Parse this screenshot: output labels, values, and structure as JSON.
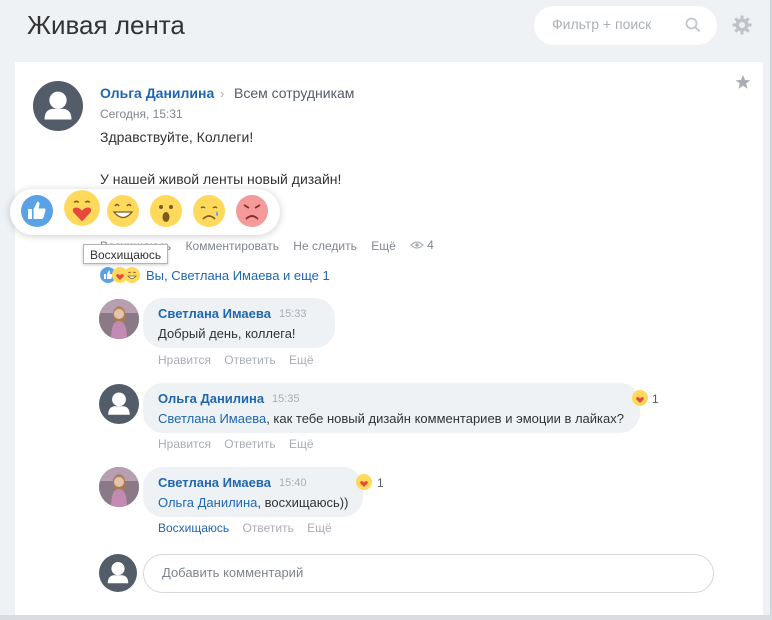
{
  "page": {
    "title": "Живая лента"
  },
  "search": {
    "placeholder": "Фильтр + поиск"
  },
  "post": {
    "author": "Ольга Данилина",
    "destination": "Всем сотрудникам",
    "time": "Сегодня, 15:31",
    "text_lines": [
      "Здравствуйте, Коллеги!",
      "У нашей живой ленты новый дизайн!"
    ],
    "actions": {
      "like": "Восхищаюсь",
      "comment": "Комментировать",
      "unfollow": "Не следить",
      "more": "Ещё"
    },
    "views": "4",
    "likers": "Вы, Светлана Имаева и еще 1"
  },
  "reactions": {
    "items": [
      "like",
      "kiss",
      "laugh",
      "wonder",
      "cry",
      "angry"
    ],
    "tooltip": "Восхищаюсь"
  },
  "comments": [
    {
      "author": "Светлана Имаева",
      "time": "15:33",
      "mention": "",
      "text": "Добрый день, коллега!",
      "actions": [
        "Нравится",
        "Ответить",
        "Ещё"
      ],
      "reaction_count": ""
    },
    {
      "author": "Ольга Данилина",
      "time": "15:35",
      "mention": "Светлана Имаева",
      "text": ", как тебе новый дизайн комментариев и эмоции в лайках?",
      "actions": [
        "Нравится",
        "Ответить",
        "Ещё"
      ],
      "reaction_count": "1"
    },
    {
      "author": "Светлана Имаева",
      "time": "15:40",
      "mention": "Ольга Данилина",
      "text": ", восхищаюсь))",
      "actions": [
        "Восхищаюсь",
        "Ответить",
        "Ещё"
      ],
      "reaction_count": "1"
    }
  ],
  "add_comment": {
    "placeholder": "Добавить комментарий"
  },
  "colors": {
    "link": "#2067b0",
    "avatar": "#535c69",
    "bubble": "#eef2f4"
  }
}
